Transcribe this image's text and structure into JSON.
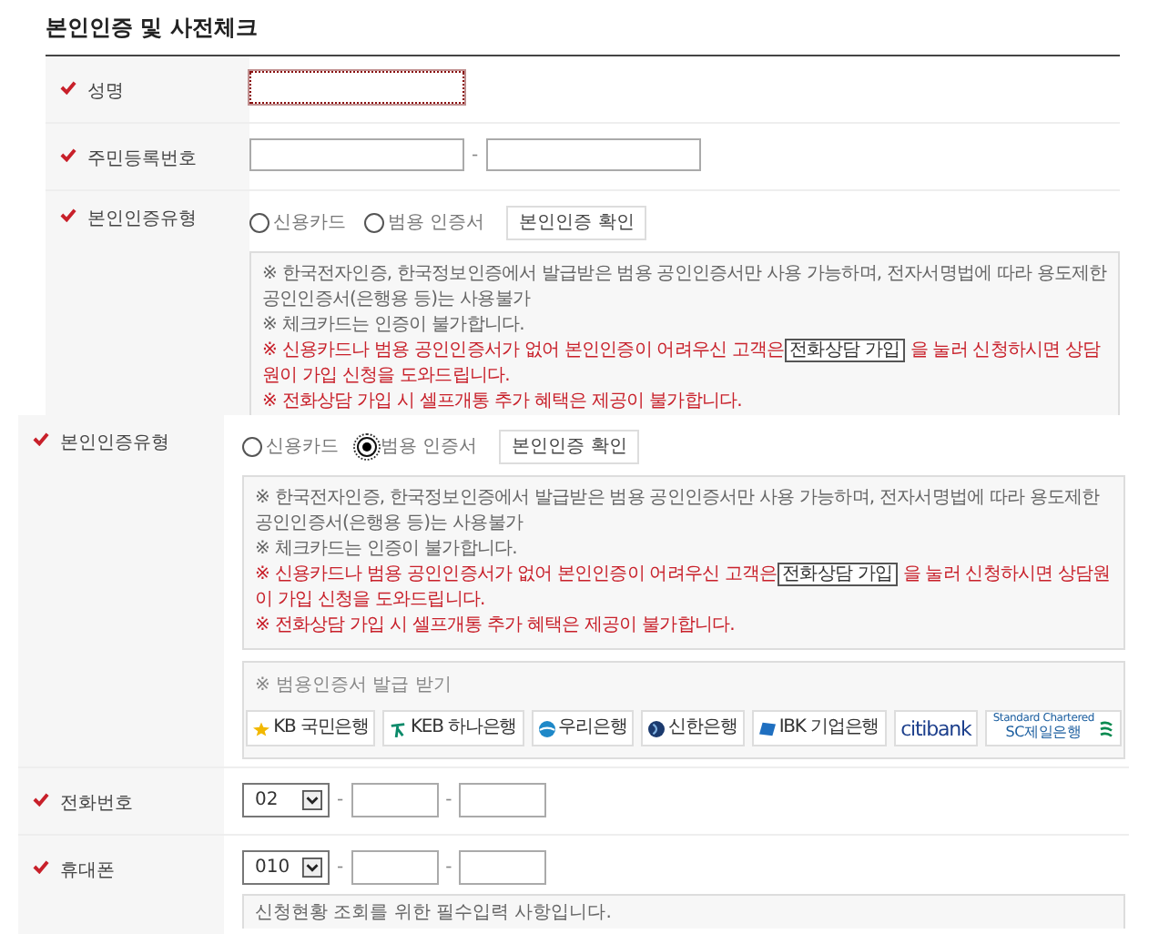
{
  "top_panel": {
    "title": "본인인증 및 사전체크",
    "rows": [
      {
        "kind": "text",
        "label": "성명",
        "required": true,
        "focused": true
      },
      {
        "kind": "ssn",
        "label": "주민등록번호",
        "required": true,
        "separator": "-"
      },
      {
        "kind": "auth",
        "label": "본인인증유형",
        "required": true,
        "options": [
          {
            "label": "신용카드",
            "selected": false
          },
          {
            "label": "범용 인증서",
            "selected": false
          }
        ],
        "confirm_button": "본인인증 확인",
        "notice": [
          {
            "warning": false,
            "text": "※ 한국전자인증, 한국정보인증에서 발급받은 범용 공인인증서만 사용 가능하며, 전자서명법에 따라 용도제한 공인인증서(은행용 등)는 사용불가"
          },
          {
            "warning": false,
            "text": "※ 체크카드는 인증이 불가합니다."
          },
          {
            "warning": true,
            "text": "※ 신용카드나 범용 공인인증서가 없어 본인인증이 어려우신 고객은",
            "button": "전화상담 가입",
            "after": "을 눌러 신청하시면 상담원이 가입 신청을 도와드립니다."
          },
          {
            "warning": true,
            "text": "※ 전화상담 가입 시 셀프개통 추가 혜택은 제공이 불가합니다."
          }
        ]
      }
    ]
  },
  "bottom_panel": {
    "rows": [
      {
        "kind": "auth",
        "label": "본인인증유형",
        "required": true,
        "options": [
          {
            "label": "신용카드",
            "selected": false
          },
          {
            "label": "범용 인증서",
            "selected": true
          }
        ],
        "confirm_button": "본인인증 확인",
        "notice": [
          {
            "warning": false,
            "text": "※ 한국전자인증, 한국정보인증에서 발급받은 범용 공인인증서만 사용 가능하며, 전자서명법에 따라 용도제한 공인인증서(은행용 등)는 사용불가"
          },
          {
            "warning": false,
            "text": "※ 체크카드는 인증이 불가합니다."
          },
          {
            "warning": true,
            "text": "※ 신용카드나 범용 공인인증서가 없어 본인인증이 어려우신 고객은",
            "button": "전화상담 가입",
            "after": "을 눌러 신청하시면 상담원이 가입 신청을 도와드립니다."
          },
          {
            "warning": true,
            "text": "※ 전화상담 가입 시 셀프개통 추가 혜택은 제공이 불가합니다."
          }
        ],
        "issuance": {
          "title": "※ 범용인증서 발급 받기",
          "banks": [
            {
              "kind": "kb",
              "lines": [
                "KB 국민은행"
              ]
            },
            {
              "kind": "keb",
              "lines": [
                "KEB 하나은행"
              ]
            },
            {
              "kind": "woori",
              "lines": [
                "우리은행"
              ]
            },
            {
              "kind": "shinhan",
              "lines": [
                "신한은행"
              ]
            },
            {
              "kind": "ibk",
              "lines": [
                "IBK 기업은행"
              ]
            },
            {
              "kind": "citi",
              "lines": [
                "citibank"
              ]
            },
            {
              "kind": "sc",
              "lines": [
                "Standard Chartered",
                "SC제일은행"
              ]
            }
          ]
        }
      },
      {
        "kind": "phone",
        "label": "전화번호",
        "required": true,
        "prefix": "02",
        "separator": "-"
      },
      {
        "kind": "phone",
        "label": "휴대폰",
        "required": true,
        "prefix": "010",
        "separator": "-",
        "hint": "신청현황 조회를 위한 필수입력 사항입니다."
      }
    ]
  }
}
